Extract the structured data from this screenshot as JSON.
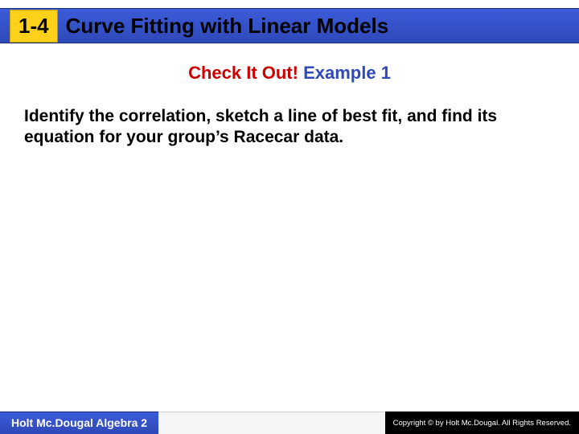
{
  "header": {
    "unit": "1-4",
    "title": "Curve Fitting with Linear Models"
  },
  "subhead": {
    "checkitout": "Check It Out!",
    "example": "Example 1"
  },
  "body": {
    "text": "Identify the correlation, sketch a line of best fit, and find its equation for your group’s Racecar data."
  },
  "footer": {
    "left": "Holt Mc.Dougal Algebra 2",
    "right": "Copyright © by Holt Mc.Dougal. All Rights Reserved."
  }
}
